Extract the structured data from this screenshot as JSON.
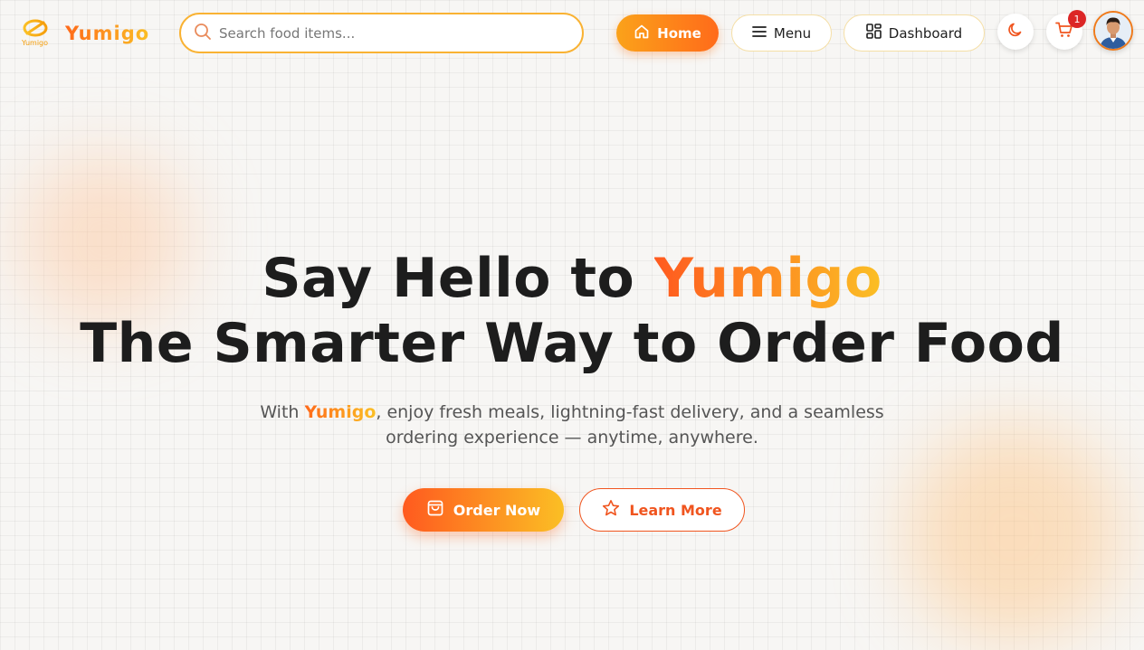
{
  "brand": {
    "name": "Yumigo",
    "mark_caption": "Yumigo",
    "gradient_start": "#ff5a1f",
    "gradient_end": "#fbbf24"
  },
  "search": {
    "placeholder": "Search food items...",
    "value": "",
    "icon": "search-icon"
  },
  "nav": {
    "items": [
      {
        "label": "Home",
        "icon": "home-icon",
        "active": true
      },
      {
        "label": "Menu",
        "icon": "menu-lines-icon",
        "active": false
      },
      {
        "label": "Dashboard",
        "icon": "dashboard-grid-icon",
        "active": false
      }
    ],
    "theme_toggle_icon": "moon-icon",
    "cart": {
      "icon": "cart-icon",
      "count": "1"
    },
    "avatar_icon": "user-avatar"
  },
  "hero": {
    "title_line1_prefix": "Say Hello to ",
    "title_line1_brand": "Yumigo",
    "title_line2": "The Smarter Way to Order Food",
    "subtitle_prefix": "With ",
    "subtitle_brand": "Yumigo",
    "subtitle_suffix": ", enjoy fresh meals, lightning-fast delivery, and a seamless ordering experience — anytime, anywhere.",
    "primary_cta": {
      "label": "Order Now",
      "icon": "shopping-bag-icon"
    },
    "secondary_cta": {
      "label": "Learn More",
      "icon": "star-icon"
    }
  },
  "colors": {
    "accent": "#ff6a1a",
    "accent_yellow": "#fbbf24",
    "badge_red": "#dc2626",
    "text_dark": "#1d1d1d"
  }
}
